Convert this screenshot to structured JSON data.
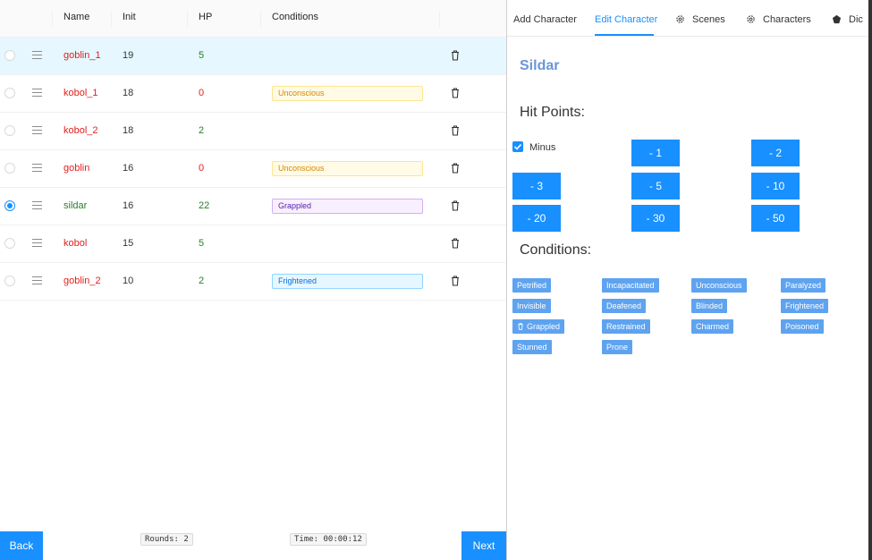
{
  "table": {
    "headers": [
      "Name",
      "Init",
      "HP",
      "Conditions"
    ],
    "rows": [
      {
        "name": "goblin_1",
        "init": "19",
        "hp": "5",
        "condition": "",
        "selected": false
      },
      {
        "name": "kobol_1",
        "init": "18",
        "hp": "0",
        "condition": "Unconscious",
        "selected": false
      },
      {
        "name": "kobol_2",
        "init": "18",
        "hp": "2",
        "condition": "",
        "selected": false
      },
      {
        "name": "goblin",
        "init": "16",
        "hp": "0",
        "condition": "Unconscious",
        "selected": false
      },
      {
        "name": "sildar",
        "init": "16",
        "hp": "22",
        "condition": "Grappled",
        "selected": true
      },
      {
        "name": "kobol",
        "init": "15",
        "hp": "5",
        "condition": "",
        "selected": false
      },
      {
        "name": "goblin_2",
        "init": "10",
        "hp": "2",
        "condition": "Frightened",
        "selected": false
      }
    ]
  },
  "footer": {
    "back_label": "Back",
    "next_label": "Next",
    "rounds": "Rounds: 2",
    "time": "Time: 00:00:12"
  },
  "tabs": [
    "Add Character",
    "Edit Character",
    "Scenes",
    "Characters",
    "Dic"
  ],
  "active_tab": "Edit Character",
  "editor": {
    "character_name": "Sildar",
    "hit_points_heading": "Hit Points:",
    "minus_label": "Minus",
    "minus_checked": true,
    "hp_buttons": [
      "- 1",
      "- 2",
      "- 3",
      "- 5",
      "- 10",
      "- 20",
      "- 30",
      "- 50"
    ],
    "conditions_heading": "Conditions:",
    "conditions": [
      "Petrified",
      "Incapacitated",
      "Unconscious",
      "Paralyzed",
      "Invisible",
      "Deafened",
      "Blinded",
      "Frightened",
      "Grappled",
      "Restrained",
      "Charmed",
      "Poisoned",
      "Stunned",
      "Prone"
    ],
    "active_condition": "Grappled"
  },
  "colors": {
    "accent": "#1890ff",
    "hp_positive": "#2a7d2a",
    "name_red": "#e0201c",
    "name_green": "#2a7d2a",
    "condition_button": "#5ea3f0"
  },
  "icons": {
    "trash": "trash-icon",
    "drag": "drag-handle-icon",
    "gear": "gear-icon",
    "check": "check-icon"
  }
}
